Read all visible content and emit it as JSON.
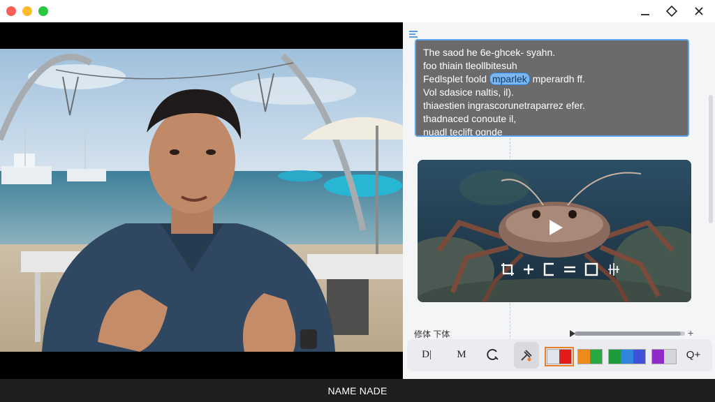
{
  "window": {
    "controls": {
      "close_color": "#fe5f57",
      "minimize_color": "#febc2e",
      "zoom_color": "#28c840",
      "right_buttons": [
        "minimize-icon",
        "restore-icon",
        "close-icon"
      ]
    }
  },
  "video": {
    "caption": "NAME NADE"
  },
  "editor": {
    "text_lines": [
      "The saod he 6e-ghcek- syahn.",
      "foo thiain tleollbitesuh",
      "Fedlsplet foold",
      "Vol sdasice naltis, il).",
      "thiaestien ingrascorunetraparrez efer.",
      "thadnaced conoute il,",
      "nuadl teclift ognde"
    ],
    "highlight_word": "mparlek",
    "line3_suffix": "mperardh ff.",
    "media": {
      "icon": "play-icon",
      "controls": [
        "crop-icon",
        "plus-icon",
        "caption-icon",
        "equals-icon",
        "frame-icon",
        "sparkle-icon"
      ]
    },
    "timeline": {
      "label": "修体 下体",
      "end_symbol": "+",
      "progress": 0.96
    },
    "toolbar": {
      "btn_d": "D|",
      "btn_m": "M",
      "btn_c": "C",
      "brush_icon": "brush-icon",
      "zoom": "Q+",
      "swatches": [
        {
          "colors": [
            "#dfe3ea",
            "#e21b1b"
          ],
          "selected": true
        },
        {
          "colors": [
            "#ef8a1a",
            "#28a745"
          ],
          "selected": false
        },
        {
          "colors": [
            "#1e9b3c",
            "#2e86de",
            "#3f51d6"
          ],
          "selected": false
        },
        {
          "colors": [
            "#8e2bc9",
            "#d5d6da"
          ],
          "selected": false
        }
      ]
    }
  }
}
